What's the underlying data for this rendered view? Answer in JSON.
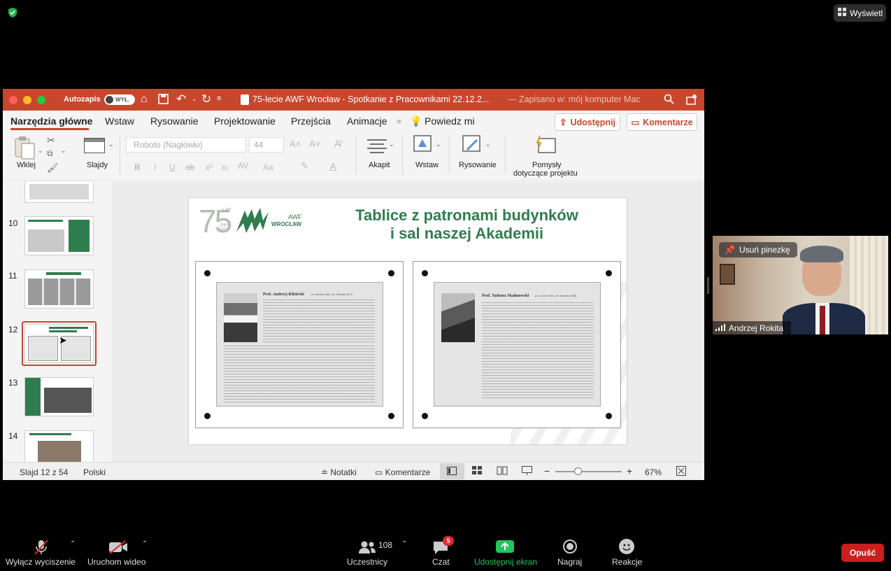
{
  "top": {
    "view_button": "Wyświetl"
  },
  "ppt": {
    "autosave_label": "Autozapis",
    "autosave_state": "WYŁ.",
    "doc_title": "75-lecie AWF Wrocław - Spotkanie z Pracownikami 22.12.2...",
    "save_status": "— Zapisano w: mój komputer Mac",
    "tabs": [
      "Narzędzia główne",
      "Wstaw",
      "Rysowanie",
      "Projektowanie",
      "Przejścia",
      "Animacje",
      "Powiedz mi"
    ],
    "share_button": "Udostępnij",
    "comments_button": "Komentarze",
    "ribbon": {
      "paste": "Wklej",
      "slides": "Slajdy",
      "font": "Roboto (Nagłówki)",
      "font_size": "44",
      "paragraph": "Akapit",
      "insert": "Wstaw",
      "drawing": "Rysowanie",
      "ideas_1": "Pomysły",
      "ideas_2": "dotyczące projektu"
    },
    "thumb_numbers": [
      "10",
      "11",
      "12",
      "13",
      "14"
    ],
    "slide": {
      "title_line1": "Tablice z patronami budynków",
      "title_line2": "i sal naszej Akademii",
      "logo_number": "75",
      "logo_lat": "LAT",
      "logo_years": "1946 / 2021",
      "logo_awf": "AWF",
      "logo_city": "WROCŁAW",
      "poster1_name": "Prof. Andrzej Klisiecki",
      "poster1_dates": "(ur. Brzesko 1893, zm. Wrocław 1971)",
      "poster2_name": "Prof. Tadeusz Skalmowski",
      "poster2_dates": "(ur. Lubomil 1909, zm. Wrocław 1988)"
    },
    "status": {
      "slide_of": "Slajd 12 z 54",
      "language": "Polski",
      "notes": "Notatki",
      "comments": "Komentarze",
      "zoom": "67%"
    }
  },
  "video": {
    "unpin": "Usuń pinezkę",
    "name": "Andrzej Rokita"
  },
  "toolbar": {
    "mute": "Wyłącz wyciszenie",
    "video": "Uruchom wideo",
    "participants_count": "108",
    "participants": "Uczestnicy",
    "chat": "Czat",
    "chat_badge": "5",
    "share": "Udostępnij ekran",
    "record": "Nagraj",
    "reactions": "Reakcje",
    "leave": "Opuść"
  },
  "colors": {
    "ppt_accent": "#c8462c",
    "slide_green": "#2f7d4e",
    "share_green": "#22c55e",
    "leave_red": "#c9201e"
  }
}
